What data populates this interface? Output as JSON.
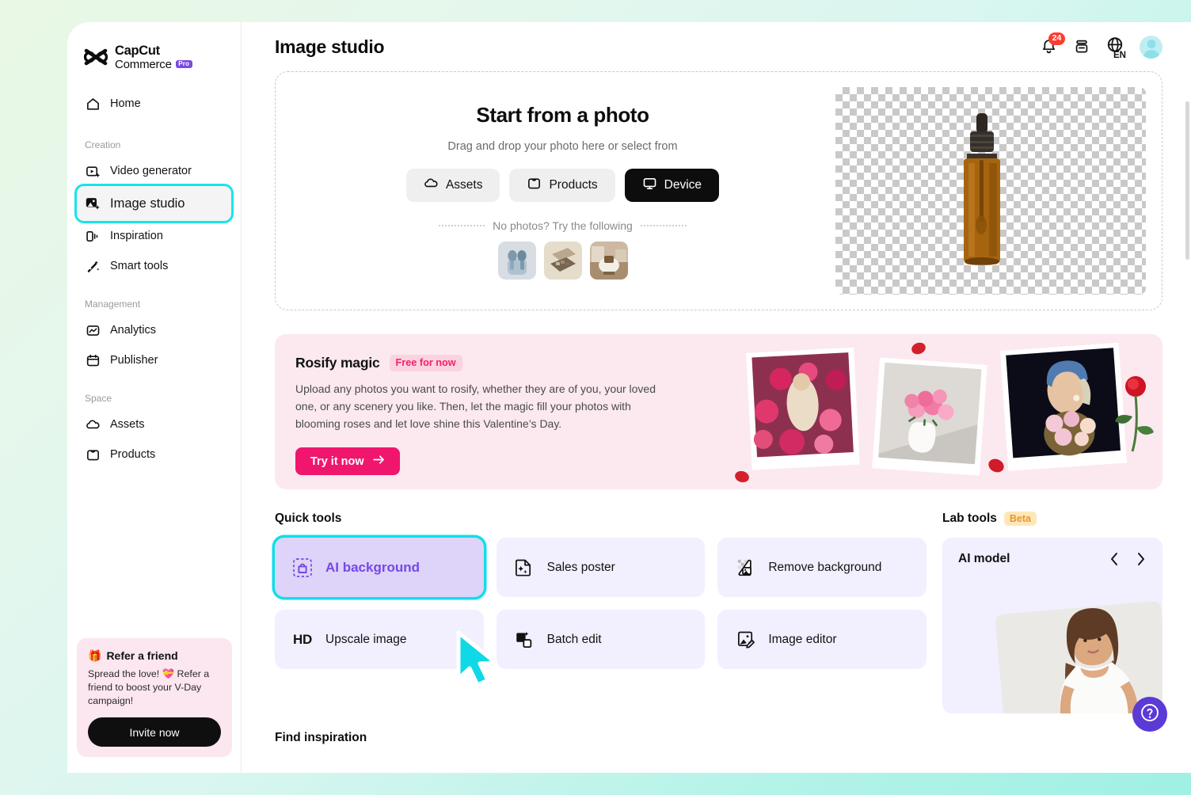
{
  "brand": {
    "line1": "CapCut",
    "line2": "Commerce",
    "badge": "Pro"
  },
  "sidebar": {
    "home": {
      "label": "Home",
      "icon": "home-icon"
    },
    "sections": [
      {
        "label": "Creation",
        "items": [
          {
            "label": "Video generator",
            "icon": "video-generator-icon",
            "active": false
          },
          {
            "label": "Image studio",
            "icon": "image-studio-icon",
            "active": true
          },
          {
            "label": "Inspiration",
            "icon": "inspiration-icon",
            "active": false
          },
          {
            "label": "Smart tools",
            "icon": "smart-tools-icon",
            "active": false
          }
        ]
      },
      {
        "label": "Management",
        "items": [
          {
            "label": "Analytics",
            "icon": "analytics-icon",
            "active": false
          },
          {
            "label": "Publisher",
            "icon": "publisher-icon",
            "active": false
          }
        ]
      },
      {
        "label": "Space",
        "items": [
          {
            "label": "Assets",
            "icon": "cloud-icon",
            "active": false
          },
          {
            "label": "Products",
            "icon": "bag-icon",
            "active": false
          }
        ]
      }
    ],
    "refer": {
      "emoji": "🎁",
      "title": "Refer a friend",
      "body": "Spread the love! 💝 Refer a friend to boost your V-Day campaign!",
      "button": "Invite now"
    }
  },
  "header": {
    "title": "Image studio",
    "notifications_count": "24",
    "notifications_icon": "bell-icon",
    "inbox_icon": "inbox-icon",
    "language": "EN",
    "language_icon": "globe-icon",
    "avatar_icon": "avatar"
  },
  "upload": {
    "title": "Start from a photo",
    "subtitle": "Drag and drop your photo here or select from",
    "buttons": [
      {
        "label": "Assets",
        "icon": "cloud-icon",
        "primary": false
      },
      {
        "label": "Products",
        "icon": "bag-icon",
        "primary": false
      },
      {
        "label": "Device",
        "icon": "monitor-icon",
        "primary": true
      }
    ],
    "no_photos_text": "No photos? Try the following",
    "samples": [
      {
        "name": "earbuds-sample"
      },
      {
        "name": "eyeshadow-palette-sample"
      },
      {
        "name": "armchair-sample"
      }
    ],
    "preview": {
      "name": "amber-dropper-bottle",
      "background": "transparent-checkerboard"
    }
  },
  "rosify": {
    "title": "Rosify magic",
    "chip": "Free for now",
    "body": "Upload any photos you want to rosify, whether they are of you, your loved one, or any scenery you like. Then, let the magic fill your photos with blooming roses and let love shine this Valentine’s Day.",
    "cta": "Try it now",
    "cta_icon": "arrow-right-icon",
    "photos": [
      {
        "name": "woman-in-roses-photo"
      },
      {
        "name": "vase-of-roses-photo"
      },
      {
        "name": "girl-with-pearl-earring-photo"
      }
    ]
  },
  "quick_tools": {
    "title": "Quick tools",
    "items": [
      {
        "label": "AI background",
        "icon": "ai-background-icon",
        "highlighted": true
      },
      {
        "label": "Sales poster",
        "icon": "sales-poster-icon",
        "highlighted": false
      },
      {
        "label": "Remove background",
        "icon": "remove-background-icon",
        "highlighted": false
      },
      {
        "label": "Upscale image",
        "icon": "hd-icon",
        "icon_text": "HD",
        "highlighted": false
      },
      {
        "label": "Batch edit",
        "icon": "batch-edit-icon",
        "highlighted": false
      },
      {
        "label": "Image editor",
        "icon": "image-editor-icon",
        "highlighted": false
      }
    ]
  },
  "lab_tools": {
    "title": "Lab tools",
    "chip": "Beta",
    "card": {
      "name": "AI model",
      "prev_icon": "chevron-left-icon",
      "next_icon": "chevron-right-icon",
      "image": "ai-model-woman-photo"
    }
  },
  "find_inspiration": {
    "title": "Find inspiration"
  },
  "help": {
    "icon": "help-icon"
  },
  "colors": {
    "accent_cyan": "#0fdfe8",
    "accent_purple": "#7547e8",
    "pink": "#f0166e",
    "badge_red": "#ff3b30",
    "tool_card_bg": "#f2efff",
    "rosify_bg": "#fce9ef"
  }
}
